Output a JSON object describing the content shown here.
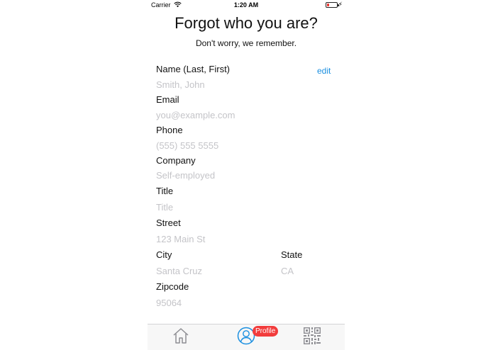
{
  "status_bar": {
    "carrier": "Carrier",
    "time": "1:20 AM",
    "bolt": "⚡"
  },
  "header": {
    "title": "Forgot who you are?",
    "subtitle": "Don't worry, we remember."
  },
  "edit_label": "edit",
  "fields": {
    "name": {
      "label": "Name (Last, First)",
      "placeholder": "Smith, John"
    },
    "email": {
      "label": "Email",
      "placeholder": "you@example.com"
    },
    "phone": {
      "label": "Phone",
      "placeholder": "(555) 555 5555"
    },
    "company": {
      "label": "Company",
      "placeholder": "Self-employed"
    },
    "title": {
      "label": "Title",
      "placeholder": "Title"
    },
    "street": {
      "label": "Street",
      "placeholder": "123 Main St"
    },
    "city": {
      "label": "City",
      "placeholder": "Santa Cruz"
    },
    "state": {
      "label": "State",
      "placeholder": "CA"
    },
    "zipcode": {
      "label": "Zipcode",
      "placeholder": "95064"
    }
  },
  "tab_bar": {
    "tabs": [
      {
        "icon": "home-icon"
      },
      {
        "icon": "profile-icon",
        "badge": "Profile"
      },
      {
        "icon": "qr-code-icon"
      }
    ]
  },
  "colors": {
    "accent": "#1a8fe0",
    "badge": "#f23c3c",
    "placeholder": "#c4c4c8"
  }
}
